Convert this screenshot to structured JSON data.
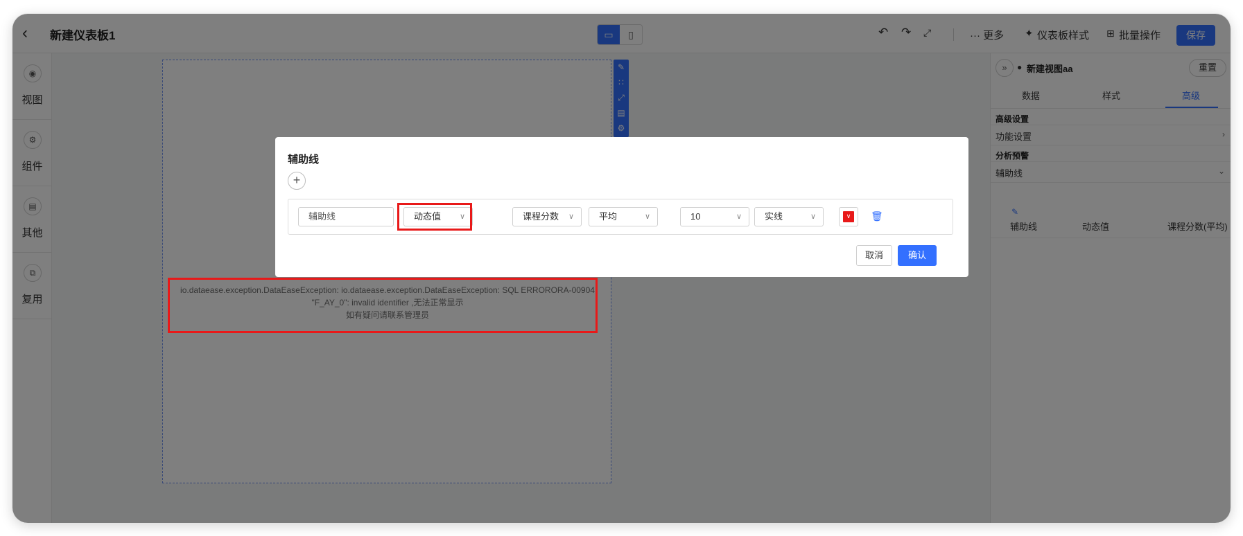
{
  "header": {
    "back_icon": "chevron-left-icon",
    "title": "新建仪表板1",
    "more": "··· 更多",
    "dashboard_style": "仪表板样式",
    "batch_ops": "批量操作",
    "save": "保存"
  },
  "left_rail": {
    "items": [
      {
        "label": "视图",
        "icon": "target-icon"
      },
      {
        "label": "组件",
        "icon": "gear-icon"
      },
      {
        "label": "其他",
        "icon": "box-icon"
      },
      {
        "label": "复用",
        "icon": "copy-icon"
      }
    ]
  },
  "canvas": {
    "error_line1": "io.dataease.exception.DataEaseException: io.dataease.exception.DataEaseException: SQL ERRORORA-00904",
    "error_line2": "\"F_AY_0\": invalid identifier ,无法正常显示",
    "error_line3": "如有疑问请联系管理员"
  },
  "right_panel": {
    "view_name": "新建视图aa",
    "reset": "重置",
    "tabs": [
      "数据",
      "样式",
      "高级"
    ],
    "active_tab": "高级",
    "section_advanced": "高级设置",
    "feature_settings": "功能设置",
    "section_analysis": "分析预警",
    "auxiliary_line": "辅助线",
    "table": {
      "name": "辅助线",
      "type": "动态值",
      "field": "课程分数(平均)"
    }
  },
  "dialog": {
    "title": "辅助线",
    "row": {
      "name_value": "辅助线",
      "type_value": "动态值",
      "field_value": "课程分数",
      "agg_value": "平均",
      "width_value": "10",
      "style_value": "实线",
      "color": "#e81919"
    },
    "cancel": "取消",
    "confirm": "确认"
  }
}
